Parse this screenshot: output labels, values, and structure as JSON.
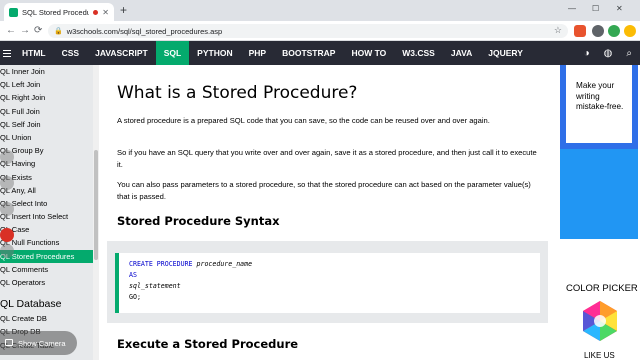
{
  "browser": {
    "tab_title": "SQL Stored Procedures",
    "tab_close": "✕",
    "new_tab": "+",
    "url": "w3schools.com/sql/sql_stored_procedures.asp",
    "lock": "🔒",
    "nav_back": "←",
    "nav_forward": "→",
    "nav_reload": "⟳",
    "star": "☆",
    "min": "—",
    "max": "☐",
    "close": "✕"
  },
  "topnav": {
    "items": [
      "HTML",
      "CSS",
      "JAVASCRIPT",
      "SQL",
      "PYTHON",
      "PHP",
      "BOOTSTRAP",
      "HOW TO",
      "W3.CSS",
      "JAVA",
      "JQUERY"
    ],
    "active_index": 3
  },
  "sidebar": {
    "items": [
      "QL Inner Join",
      "QL Left Join",
      "QL Right Join",
      "QL Full Join",
      "QL Self Join",
      "QL Union",
      "QL Group By",
      "QL Having",
      "QL Exists",
      "QL Any, All",
      "QL Select Into",
      "QL Insert Into Select",
      "QL Case",
      "QL Null Functions",
      "QL Stored Procedures",
      "QL Comments",
      "QL Operators"
    ],
    "active_index": 14,
    "section_title": "QL Database",
    "section_items": [
      "QL Create DB",
      "QL Drop DB",
      "QL Create Table"
    ]
  },
  "main": {
    "title": "What is a Stored Procedure?",
    "p1": "A stored procedure is a prepared SQL code that you can save, so the code can be reused over and over again.",
    "p2": "So if you have an SQL query that you write over and over again, save it as a stored procedure, and then just call it to execute it.",
    "p3": "You can also pass parameters to a stored procedure, so that the stored procedure can act based on the parameter value(s) that is passed.",
    "syntax_title": "Stored Procedure Syntax",
    "code": {
      "kw1": "CREATE PROCEDURE",
      "name": "procedure_name",
      "kw2": "AS",
      "stmt": "sql_statement",
      "go": "GO;"
    },
    "exec_title": "Execute a Stored Procedure"
  },
  "right": {
    "ad_text": "Make your writing mistake-free.",
    "color_picker": "COLOR PICKER",
    "like": "LIKE US"
  },
  "camera": {
    "label": "Show Camera"
  },
  "colors": {
    "accent": "#04aa6d",
    "topnav": "#282a35",
    "sidebar": "#e7e9eb"
  }
}
